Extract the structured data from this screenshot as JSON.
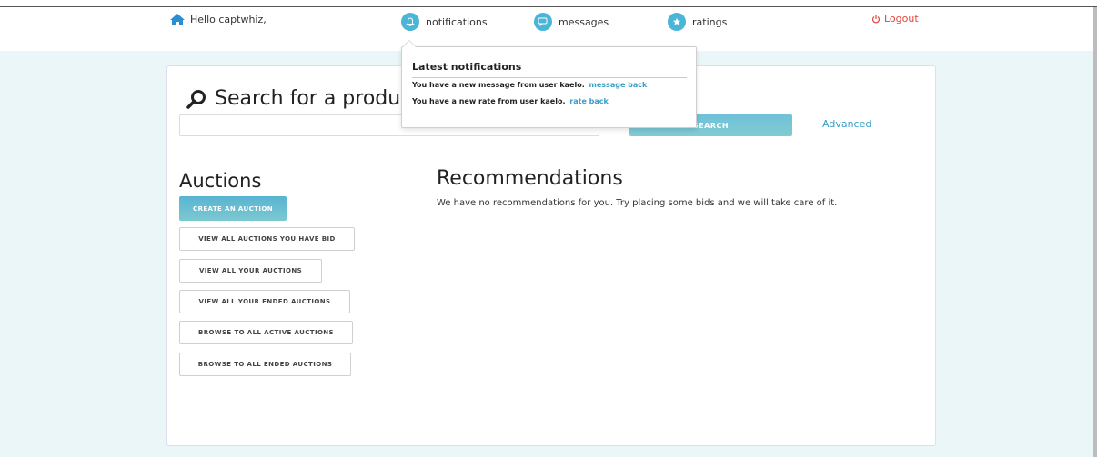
{
  "nav": {
    "hello": "Hello captwhiz,",
    "notifications": "notifications",
    "messages": "messages",
    "ratings": "ratings",
    "logout": "Logout",
    "icons": {
      "home": "home-icon",
      "notifications": "bell-icon",
      "messages": "chat-icon",
      "ratings": "star-icon",
      "logout": "power-icon"
    }
  },
  "search": {
    "title": "Search for a product",
    "placeholder": "",
    "button_label": "SEARCH",
    "advanced_label": "Advanced"
  },
  "auctions": {
    "title": "Auctions",
    "create_label": "CREATE AN AUCTION",
    "buttons": [
      "VIEW ALL AUCTIONS YOU HAVE BID",
      "VIEW ALL YOUR AUCTIONS",
      "VIEW ALL YOUR ENDED AUCTIONS",
      "BROWSE TO ALL ACTIVE AUCTIONS",
      "BROWSE TO ALL ENDED AUCTIONS"
    ]
  },
  "recommendations": {
    "title": "Recommendations",
    "text": "We have no recommendations for you. Try placing some bids and we will take care of it."
  },
  "notifications_popover": {
    "title": "Latest notifications",
    "items": [
      {
        "text": "You have a new message from user kaelo.",
        "link": "message back"
      },
      {
        "text": "You have a new rate from user kaelo.",
        "link": "rate back"
      }
    ]
  },
  "colors": {
    "accent": "#4ab5d6",
    "link": "#3a9fc6",
    "logout": "#e0453a",
    "page_bg": "#eaf6f8"
  }
}
